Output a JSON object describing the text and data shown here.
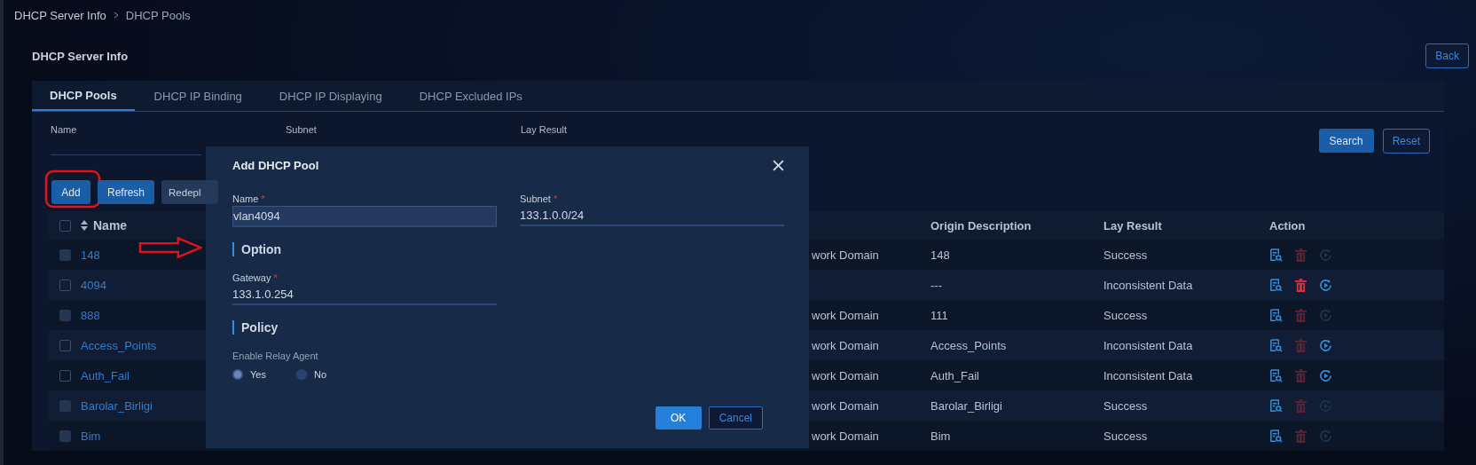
{
  "breadcrumb": [
    "DHCP Server Info",
    "DHCP Pools"
  ],
  "page_title": "DHCP Server Info",
  "back_button": "Back",
  "tabs": [
    {
      "label": "DHCP Pools",
      "selected": true
    },
    {
      "label": "DHCP IP Binding",
      "selected": false
    },
    {
      "label": "DHCP IP Displaying",
      "selected": false
    },
    {
      "label": "DHCP Excluded IPs",
      "selected": false
    }
  ],
  "filters": [
    "Name",
    "Subnet",
    "Lay Result"
  ],
  "search_button": "Search",
  "reset_button": "Reset",
  "toolbar": [
    "Add",
    "Refresh",
    "Redepl"
  ],
  "table": {
    "select_all_checked": false,
    "columns": [
      "Name",
      "",
      "Origin Description",
      "Lay Result",
      "Action"
    ],
    "rows": [
      {
        "name": "148",
        "column_2": "work Domain",
        "origin": "148",
        "result": "Success",
        "checkbox_disabled": true,
        "delete_enabled": false,
        "redeploy_enabled": false
      },
      {
        "name": "4094",
        "column_2": "",
        "origin": "---",
        "result": "Inconsistent Data",
        "checkbox_disabled": false,
        "delete_enabled": true,
        "redeploy_enabled": true
      },
      {
        "name": "888",
        "column_2": "work Domain",
        "origin": "111",
        "result": "Success",
        "checkbox_disabled": true,
        "delete_enabled": false,
        "redeploy_enabled": false
      },
      {
        "name": "Access_Points",
        "column_2": "work Domain",
        "origin": "Access_Points",
        "result": "Inconsistent Data",
        "checkbox_disabled": false,
        "delete_enabled": false,
        "redeploy_enabled": true
      },
      {
        "name": "Auth_Fail",
        "column_2": "work Domain",
        "origin": "Auth_Fail",
        "result": "Inconsistent Data",
        "checkbox_disabled": false,
        "delete_enabled": false,
        "redeploy_enabled": true
      },
      {
        "name": "Barolar_Birligi",
        "column_2": "work Domain",
        "origin": "Barolar_Birligi",
        "result": "Success",
        "checkbox_disabled": true,
        "delete_enabled": false,
        "redeploy_enabled": false
      },
      {
        "name": "Bim",
        "column_2": "work Domain",
        "origin": "Bim",
        "result": "Success",
        "checkbox_disabled": true,
        "delete_enabled": false,
        "redeploy_enabled": false
      }
    ]
  },
  "dialog": {
    "title": "Add DHCP Pool",
    "required_mark": "*",
    "name_label": "Name",
    "name_value": "vlan4094",
    "subnet_label": "Subnet",
    "subnet_value": "133.1.0.0/24",
    "option_heading": "Option",
    "gateway_label": "Gateway",
    "gateway_value": "133.1.0.254",
    "policy_heading": "Policy",
    "relay_label": "Enable Relay Agent",
    "relay_options": [
      {
        "label": "Yes",
        "selected": true
      },
      {
        "label": "No",
        "selected": false
      }
    ],
    "ok_button": "OK",
    "cancel_button": "Cancel"
  }
}
